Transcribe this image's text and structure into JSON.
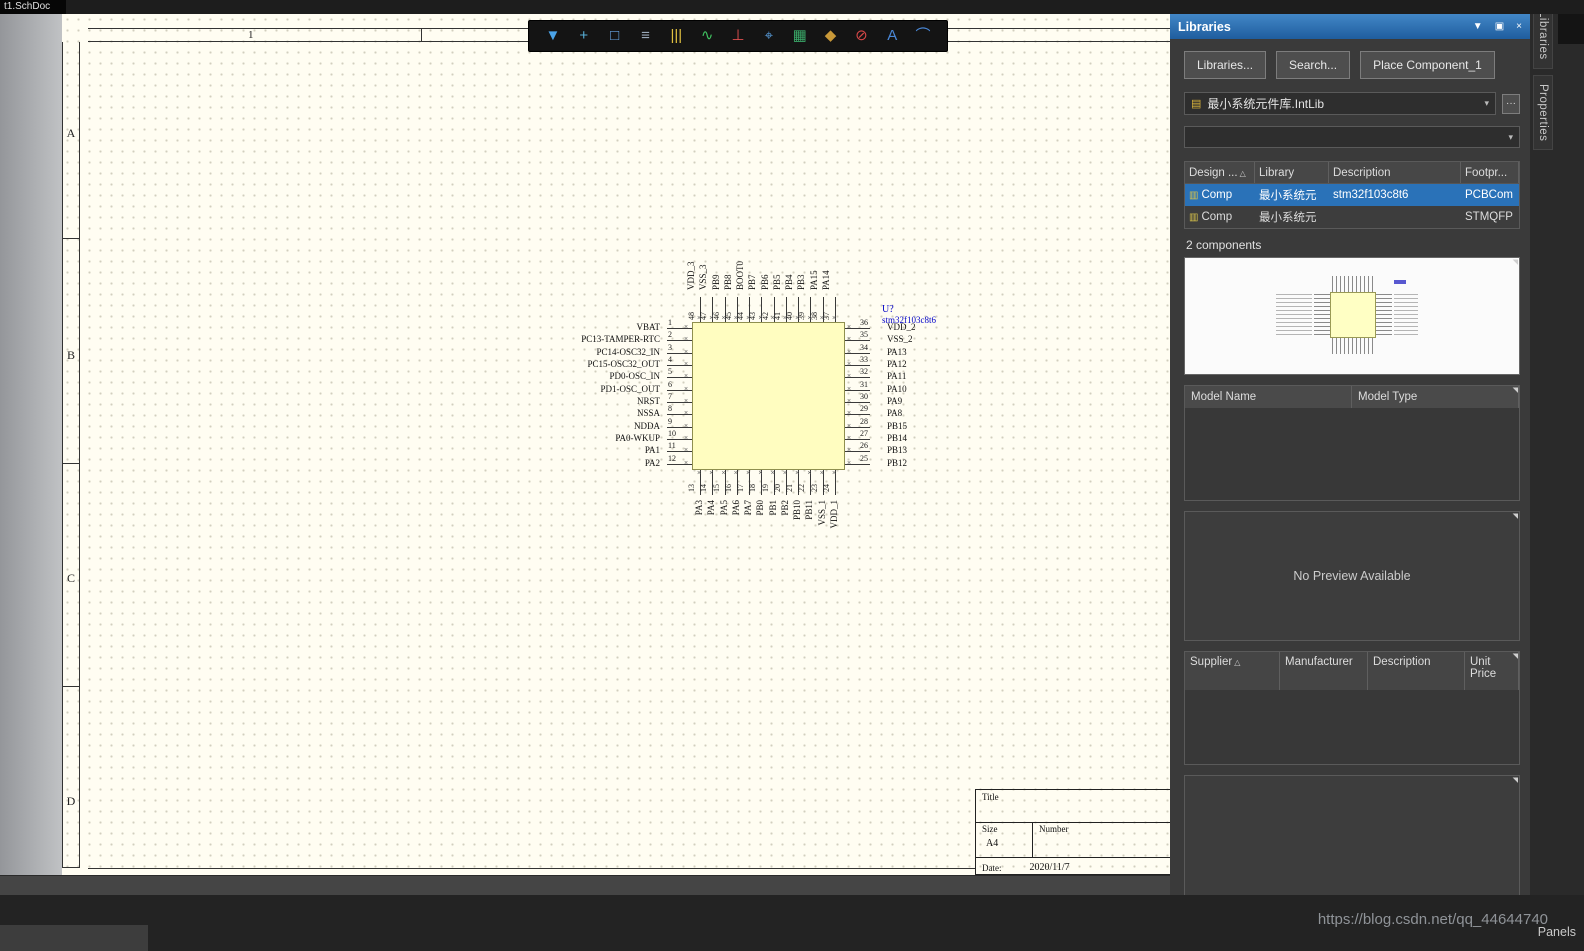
{
  "doc_tab": "t1.SchDoc",
  "right_tabs": [
    "Libraries",
    "Properties"
  ],
  "panels_label": "Panels",
  "watermark": "https://blog.csdn.net/qq_44644740",
  "icons": {
    "menu": "▼",
    "pin": "▣",
    "close": "×",
    "chevron": "▾",
    "library": "▤",
    "component": "▥",
    "sort": "△",
    "grip": "◥",
    "more": "···"
  },
  "sheet": {
    "zone_top": "1",
    "zone_rows": [
      "A",
      "B",
      "C",
      "D"
    ],
    "title_block": {
      "title_label": "Title",
      "size_label": "Size",
      "size_value": "A4",
      "number_label": "Number",
      "date_label": "Date:",
      "date_value": "2020/11/7"
    }
  },
  "chip": {
    "designator": "U?",
    "comment": "stm32f103c8t6",
    "left_pins": [
      {
        "num": "1",
        "label": "VBAT"
      },
      {
        "num": "2",
        "label": "PC13-TAMPER-RTC"
      },
      {
        "num": "3",
        "label": "PC14-OSC32_IN"
      },
      {
        "num": "4",
        "label": "PC15-OSC32_OUT"
      },
      {
        "num": "5",
        "label": "PD0-OSC_IN"
      },
      {
        "num": "6",
        "label": "PD1-OSC_OUT"
      },
      {
        "num": "7",
        "label": "NRST"
      },
      {
        "num": "8",
        "label": "NSSA"
      },
      {
        "num": "9",
        "label": "NDDA"
      },
      {
        "num": "10",
        "label": "PA0-WKUP"
      },
      {
        "num": "11",
        "label": "PA1"
      },
      {
        "num": "12",
        "label": "PA2"
      }
    ],
    "right_pins": [
      {
        "num": "36",
        "label": "VDD_2"
      },
      {
        "num": "35",
        "label": "VSS_2"
      },
      {
        "num": "34",
        "label": "PA13"
      },
      {
        "num": "33",
        "label": "PA12"
      },
      {
        "num": "32",
        "label": "PA11"
      },
      {
        "num": "31",
        "label": "PA10"
      },
      {
        "num": "30",
        "label": "PA9"
      },
      {
        "num": "29",
        "label": "PA8"
      },
      {
        "num": "28",
        "label": "PB15"
      },
      {
        "num": "27",
        "label": "PB14"
      },
      {
        "num": "26",
        "label": "PB13"
      },
      {
        "num": "25",
        "label": "PB12"
      }
    ],
    "top_pins": [
      {
        "num": "48",
        "label": "VDD_3"
      },
      {
        "num": "47",
        "label": "VSS_3"
      },
      {
        "num": "46",
        "label": "PB9"
      },
      {
        "num": "45",
        "label": "PB8"
      },
      {
        "num": "44",
        "label": "BOOT0"
      },
      {
        "num": "43",
        "label": "PB7"
      },
      {
        "num": "42",
        "label": "PB6"
      },
      {
        "num": "41",
        "label": "PB5"
      },
      {
        "num": "40",
        "label": "PB4"
      },
      {
        "num": "39",
        "label": "PB3"
      },
      {
        "num": "38",
        "label": "PA15"
      },
      {
        "num": "37",
        "label": "PA14"
      }
    ],
    "bottom_pins": [
      {
        "num": "13",
        "label": "PA3"
      },
      {
        "num": "14",
        "label": "PA4"
      },
      {
        "num": "15",
        "label": "PA5"
      },
      {
        "num": "16",
        "label": "PA6"
      },
      {
        "num": "17",
        "label": "PA7"
      },
      {
        "num": "18",
        "label": "PB0"
      },
      {
        "num": "19",
        "label": "PB1"
      },
      {
        "num": "20",
        "label": "PB2"
      },
      {
        "num": "21",
        "label": "PB10"
      },
      {
        "num": "22",
        "label": "PB11"
      },
      {
        "num": "23",
        "label": "VSS_1"
      },
      {
        "num": "24",
        "label": "VDD_1"
      }
    ]
  },
  "toolbar": {
    "icons": [
      {
        "name": "filter-icon",
        "glyph": "▼",
        "color": "#4aa3e8"
      },
      {
        "name": "crosshair-icon",
        "glyph": "+",
        "color": "#58b0d8"
      },
      {
        "name": "selection-icon",
        "glyph": "□",
        "color": "#6aa8e8"
      },
      {
        "name": "align-icon",
        "glyph": "≡",
        "color": "#9aa8b8"
      },
      {
        "name": "bars-icon",
        "glyph": "|||",
        "color": "#e0c040"
      },
      {
        "name": "wave-icon",
        "glyph": "∿",
        "color": "#40c060"
      },
      {
        "name": "power-port-icon",
        "glyph": "⊥",
        "color": "#e05050"
      },
      {
        "name": "probe-icon",
        "glyph": "⌖",
        "color": "#5aa0e0"
      },
      {
        "name": "ic-part-icon",
        "glyph": "▦",
        "color": "#3aa868"
      },
      {
        "name": "parameter-tag-icon",
        "glyph": "◆",
        "color": "#c89838"
      },
      {
        "name": "no-erc-icon",
        "glyph": "⊘",
        "color": "#d84848"
      },
      {
        "name": "text-string-icon",
        "glyph": "A",
        "color": "#4a88d8"
      },
      {
        "name": "arc-icon",
        "glyph": "⌒",
        "color": "#4a88d8"
      }
    ]
  },
  "panel": {
    "title": "Libraries",
    "buttons": [
      "Libraries...",
      "Search...",
      "Place Component_1"
    ],
    "active_library": "最小系统元件库.IntLib",
    "components_table": {
      "headers": [
        "Design ...",
        "Library",
        "Description",
        "Footpr..."
      ],
      "rows": [
        {
          "name": "Comp",
          "library": "最小系统元",
          "description": "stm32f103c8t6",
          "footprint": "PCBCom",
          "selected": true
        },
        {
          "name": "Comp",
          "library": "最小系统元",
          "description": "",
          "footprint": "STMQFP",
          "selected": false
        }
      ]
    },
    "components_count": "2 components",
    "model_headers": [
      "Model Name",
      "Model Type"
    ],
    "no_preview_text": "No Preview Available",
    "supplier_headers": [
      "Supplier",
      "Manufacturer",
      "Description",
      "Unit Price"
    ]
  }
}
